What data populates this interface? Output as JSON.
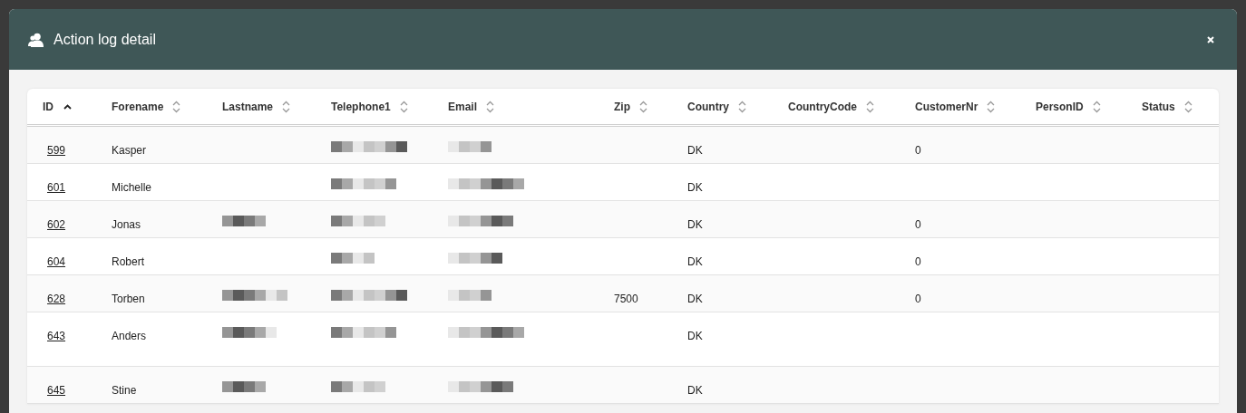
{
  "dialog": {
    "title": "Action log detail"
  },
  "table": {
    "columns": [
      {
        "label": "ID",
        "sorted": true
      },
      {
        "label": "Forename",
        "sorted": false
      },
      {
        "label": "Lastname",
        "sorted": false
      },
      {
        "label": "Telephone1",
        "sorted": false
      },
      {
        "label": "Email",
        "sorted": false
      },
      {
        "label": "Zip",
        "sorted": false
      },
      {
        "label": "Country",
        "sorted": false
      },
      {
        "label": "CountryCode",
        "sorted": false
      },
      {
        "label": "CustomerNr",
        "sorted": false
      },
      {
        "label": "PersonID",
        "sorted": false
      },
      {
        "label": "Status",
        "sorted": false
      }
    ],
    "rows": [
      {
        "cells": [
          {
            "kind": "link",
            "text": "599"
          },
          {
            "kind": "text",
            "text": "Kasper"
          },
          {
            "kind": "empty"
          },
          {
            "kind": "redacted"
          },
          {
            "kind": "redacted"
          },
          {
            "kind": "empty"
          },
          {
            "kind": "text",
            "text": "DK"
          },
          {
            "kind": "empty"
          },
          {
            "kind": "text",
            "text": "0"
          },
          {
            "kind": "empty"
          },
          {
            "kind": "empty"
          }
        ]
      },
      {
        "cells": [
          {
            "kind": "link",
            "text": "601"
          },
          {
            "kind": "text",
            "text": "Michelle"
          },
          {
            "kind": "empty"
          },
          {
            "kind": "redacted"
          },
          {
            "kind": "redacted"
          },
          {
            "kind": "empty"
          },
          {
            "kind": "text",
            "text": "DK"
          },
          {
            "kind": "empty"
          },
          {
            "kind": "empty"
          },
          {
            "kind": "empty"
          },
          {
            "kind": "empty"
          }
        ]
      },
      {
        "cells": [
          {
            "kind": "link",
            "text": "602"
          },
          {
            "kind": "text",
            "text": "Jonas"
          },
          {
            "kind": "redacted"
          },
          {
            "kind": "redacted"
          },
          {
            "kind": "redacted"
          },
          {
            "kind": "empty"
          },
          {
            "kind": "text",
            "text": "DK"
          },
          {
            "kind": "empty"
          },
          {
            "kind": "text",
            "text": "0"
          },
          {
            "kind": "empty"
          },
          {
            "kind": "empty"
          }
        ]
      },
      {
        "cells": [
          {
            "kind": "link",
            "text": "604"
          },
          {
            "kind": "text",
            "text": "Robert"
          },
          {
            "kind": "empty"
          },
          {
            "kind": "redacted"
          },
          {
            "kind": "redacted"
          },
          {
            "kind": "empty"
          },
          {
            "kind": "text",
            "text": "DK"
          },
          {
            "kind": "empty"
          },
          {
            "kind": "text",
            "text": "0"
          },
          {
            "kind": "empty"
          },
          {
            "kind": "empty"
          }
        ]
      },
      {
        "cells": [
          {
            "kind": "link",
            "text": "628"
          },
          {
            "kind": "text",
            "text": "Torben"
          },
          {
            "kind": "redacted"
          },
          {
            "kind": "redacted"
          },
          {
            "kind": "redacted"
          },
          {
            "kind": "text",
            "text": "7500"
          },
          {
            "kind": "text",
            "text": "DK"
          },
          {
            "kind": "empty"
          },
          {
            "kind": "text",
            "text": "0"
          },
          {
            "kind": "empty"
          },
          {
            "kind": "empty"
          }
        ]
      },
      {
        "cells": [
          {
            "kind": "link",
            "text": "643"
          },
          {
            "kind": "text",
            "text": "Anders"
          },
          {
            "kind": "redacted"
          },
          {
            "kind": "redacted"
          },
          {
            "kind": "redacted"
          },
          {
            "kind": "empty"
          },
          {
            "kind": "text",
            "text": "DK"
          },
          {
            "kind": "empty"
          },
          {
            "kind": "empty"
          },
          {
            "kind": "empty"
          },
          {
            "kind": "empty"
          }
        ]
      },
      {
        "cells": [
          {
            "kind": "link",
            "text": "645"
          },
          {
            "kind": "text",
            "text": "Stine"
          },
          {
            "kind": "redacted"
          },
          {
            "kind": "redacted"
          },
          {
            "kind": "redacted"
          },
          {
            "kind": "empty"
          },
          {
            "kind": "text",
            "text": "DK"
          },
          {
            "kind": "empty"
          },
          {
            "kind": "empty"
          },
          {
            "kind": "empty"
          },
          {
            "kind": "empty"
          }
        ]
      }
    ]
  }
}
